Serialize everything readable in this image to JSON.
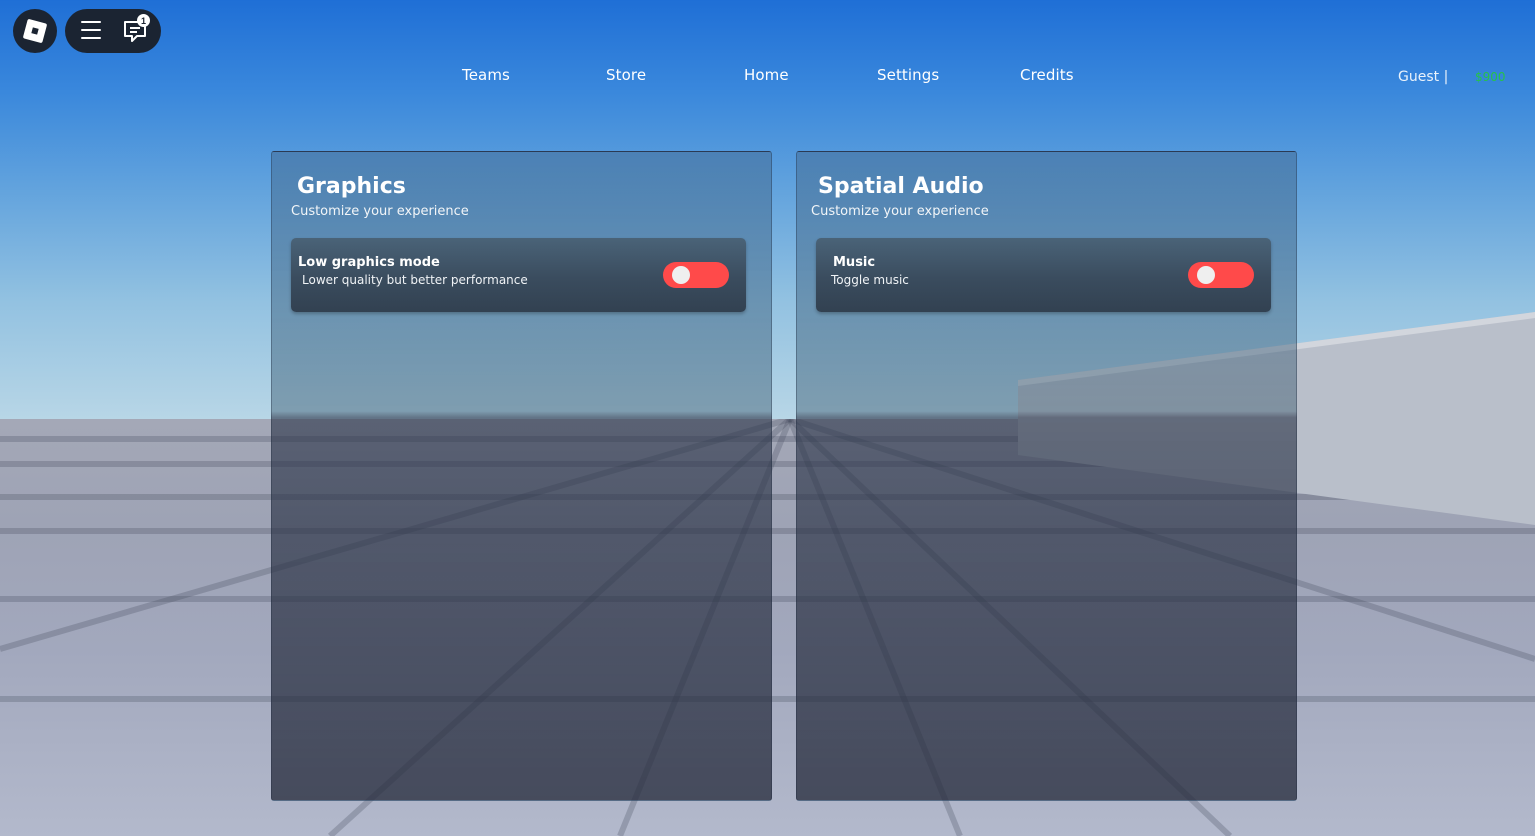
{
  "topbar": {
    "logo_icon": "roblox-logo-icon",
    "menu_icon": "hamburger-menu-icon",
    "chat_icon": "chat-icon",
    "chat_badge": "1"
  },
  "nav": {
    "items": [
      "Teams",
      "Store",
      "Home",
      "Settings",
      "Credits"
    ]
  },
  "user": {
    "name": "Guest |",
    "money": "$900",
    "money_color": "#26c24a"
  },
  "panels": [
    {
      "title": "Graphics",
      "subtitle": "Customize your experience",
      "setting": {
        "name": "Low graphics mode",
        "description": "Lower quality but better performance",
        "toggle_state": "off",
        "toggle_color": "#ff4a4a"
      }
    },
    {
      "title": "Spatial Audio",
      "subtitle": "Customize your experience",
      "setting": {
        "name": "Music",
        "description": "Toggle music",
        "toggle_state": "off",
        "toggle_color": "#ff4a4a"
      }
    }
  ]
}
